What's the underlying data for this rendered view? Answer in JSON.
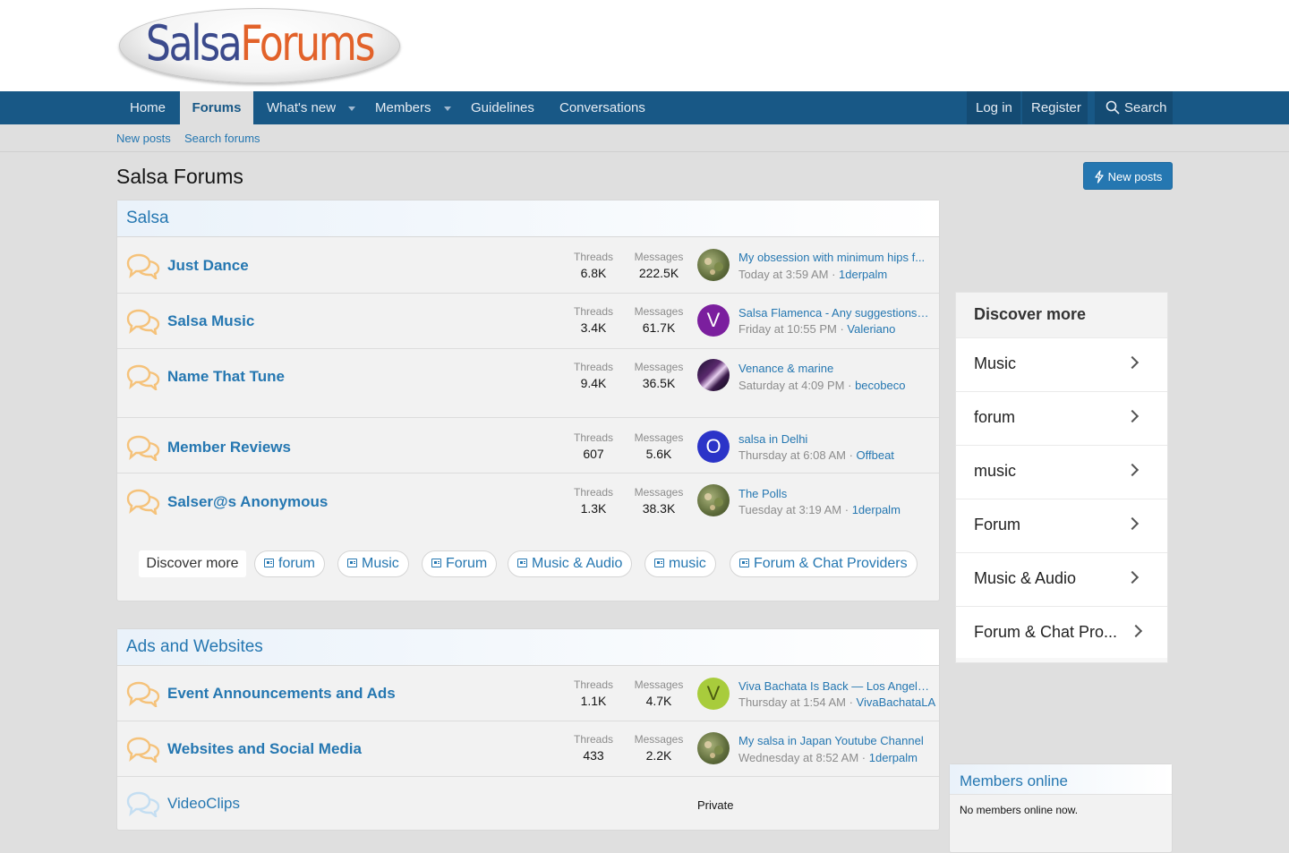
{
  "logo": {
    "part1": "Salsa",
    "part2": "Forums"
  },
  "nav": {
    "items": [
      {
        "label": "Home",
        "active": false
      },
      {
        "label": "Forums",
        "active": true
      },
      {
        "label": "What's new",
        "active": false
      },
      {
        "label": "Members",
        "active": false
      },
      {
        "label": "Guidelines",
        "active": false
      },
      {
        "label": "Conversations",
        "active": false
      }
    ],
    "login": "Log in",
    "register": "Register",
    "search": "Search"
  },
  "subnav": {
    "new_posts": "New posts",
    "search_forums": "Search forums"
  },
  "page": {
    "title": "Salsa Forums",
    "new_posts_button": "New posts"
  },
  "labels": {
    "threads": "Threads",
    "messages": "Messages"
  },
  "categories": [
    {
      "title": "Salsa",
      "nodes": [
        {
          "title": "Just Dance",
          "threads": "6.8K",
          "messages": "222.5K",
          "last_title": "My obsession with minimum hips f...",
          "last_time": "Today at 3:59 AM",
          "last_user": "1derpalm",
          "avatar": "photo"
        },
        {
          "title": "Salsa Music",
          "threads": "3.4K",
          "messages": "61.7K",
          "last_title": "Salsa Flamenca - Any suggestions f...",
          "last_time": "Friday at 10:55 PM",
          "last_user": "Valeriano",
          "avatar": "V",
          "avatar_color": "#7b1f9e"
        },
        {
          "title": "Name That Tune",
          "threads": "9.4K",
          "messages": "36.5K",
          "last_title": "Venance & marine",
          "last_time": "Saturday at 4:09 PM",
          "last_user": "becobeco",
          "avatar": "photo2"
        },
        {
          "title": "Member Reviews",
          "threads": "607",
          "messages": "5.6K",
          "last_title": "salsa in Delhi",
          "last_time": "Thursday at 6:08 AM",
          "last_user": "Offbeat",
          "avatar": "O",
          "avatar_color": "#2b34c8"
        },
        {
          "title": "Salser@s Anonymous",
          "threads": "1.3K",
          "messages": "38.3K",
          "last_title": "The Polls",
          "last_time": "Tuesday at 3:19 AM",
          "last_user": "1derpalm",
          "avatar": "photo"
        }
      ],
      "discover_label": "Discover more",
      "chips": [
        "forum",
        "Music",
        "Forum",
        "Music & Audio",
        "music",
        "Forum & Chat Providers"
      ]
    },
    {
      "title": "Ads and Websites",
      "nodes": [
        {
          "title": "Event Announcements and Ads",
          "threads": "1.1K",
          "messages": "4.7K",
          "last_title": "Viva Bachata Is Back — Los Angeles...",
          "last_time": "Thursday at 1:54 AM",
          "last_user": "VivaBachataLA",
          "avatar": "V",
          "avatar_color": "#a8cc3c"
        },
        {
          "title": "Websites and Social Media",
          "threads": "433",
          "messages": "2.2K",
          "last_title": "My salsa in Japan Youtube Channel",
          "last_time": "Wednesday at 8:52 AM",
          "last_user": "1derpalm",
          "avatar": "photo"
        },
        {
          "title": "VideoClips",
          "private": "Private"
        }
      ]
    }
  ],
  "sidebar_discover": {
    "title": "Discover more",
    "items": [
      "Music",
      "forum",
      "music",
      "Forum",
      "Music & Audio",
      "Forum & Chat Pro..."
    ]
  },
  "members_online": {
    "title": "Members online",
    "text": "No members online now."
  },
  "colors": {
    "accent": "#2577b1",
    "nav_bg": "#185886",
    "icon_orange": "#f5c27a"
  }
}
